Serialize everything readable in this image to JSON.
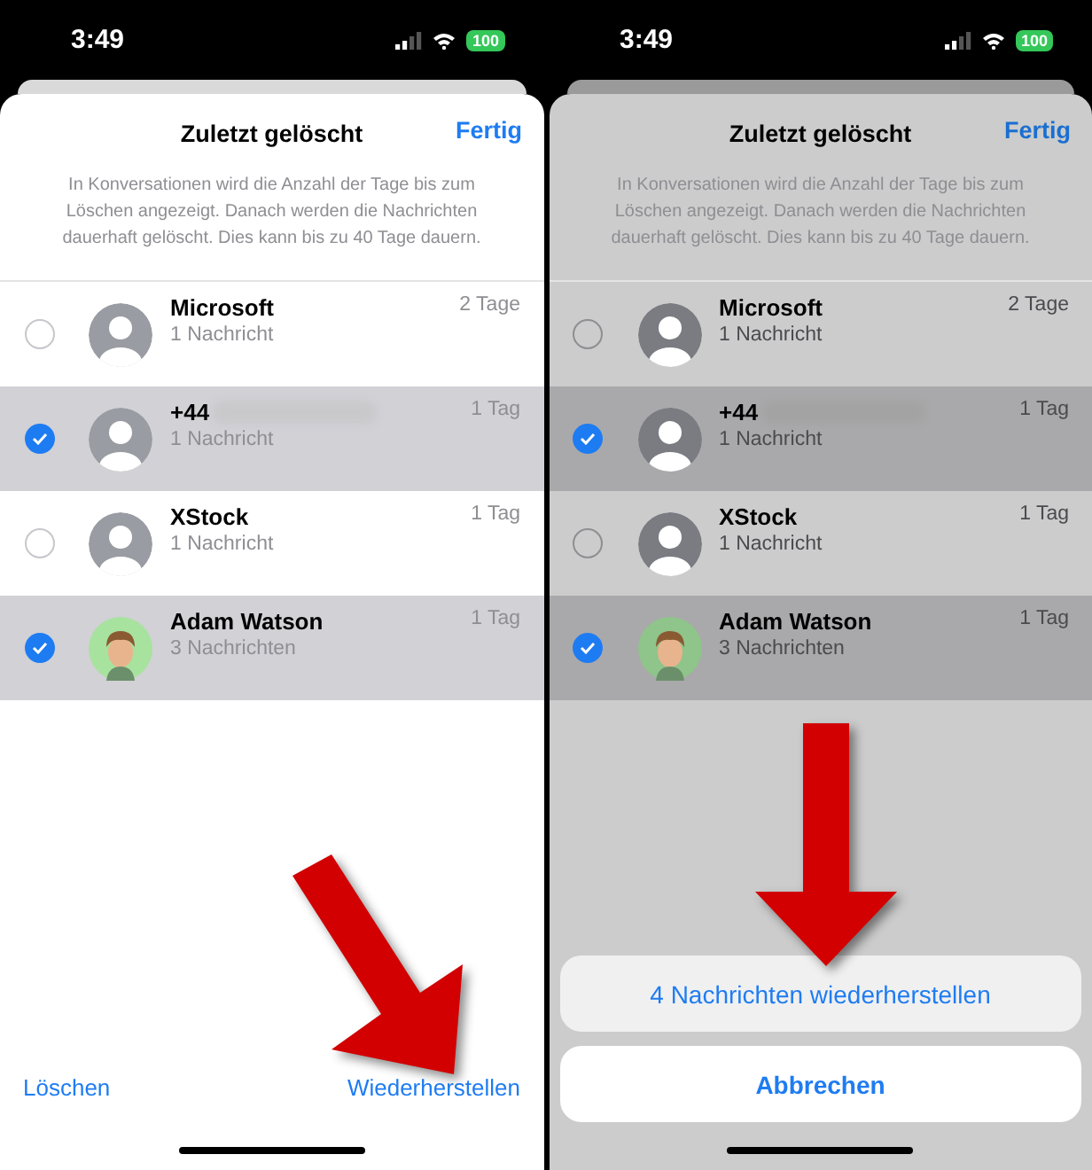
{
  "screens": [
    {
      "status_bar": {
        "time": "3:49",
        "battery": "100"
      },
      "dimmed": false,
      "sheet": {
        "title": "Zuletzt gelöscht",
        "done_button": "Fertig",
        "description": "In Konversationen wird die Anzahl der Tage bis zum Löschen angezeigt. Danach werden die Nachrichten dauerhaft gelöscht. Dies kann bis zu 40 Tage dauern.",
        "conversations": [
          {
            "name": "Microsoft",
            "count": "1 Nachricht",
            "age": "2 Tage",
            "selected": false,
            "blurred": false,
            "avatar": {
              "kind": "placeholder"
            }
          },
          {
            "name": "+44",
            "count": "1 Nachricht",
            "age": "1 Tag",
            "selected": true,
            "blurred": true,
            "avatar": {
              "kind": "placeholder"
            }
          },
          {
            "name": "XStock",
            "count": "1 Nachricht",
            "age": "1 Tag",
            "selected": false,
            "blurred": false,
            "avatar": {
              "kind": "placeholder"
            }
          },
          {
            "name": "Adam Watson",
            "count": "3 Nachrichten",
            "age": "1 Tag",
            "selected": true,
            "blurred": false,
            "avatar": {
              "kind": "memoji"
            }
          }
        ]
      },
      "toolbar": {
        "left": "Löschen",
        "right": "Wiederherstellen"
      },
      "annotation_arrow": {
        "kind": "diagonal"
      }
    },
    {
      "status_bar": {
        "time": "3:49",
        "battery": "100"
      },
      "dimmed": true,
      "sheet": {
        "title": "Zuletzt gelöscht",
        "done_button": "Fertig",
        "description": "In Konversationen wird die Anzahl der Tage bis zum Löschen angezeigt. Danach werden die Nachrichten dauerhaft gelöscht. Dies kann bis zu 40 Tage dauern.",
        "conversations": [
          {
            "name": "Microsoft",
            "count": "1 Nachricht",
            "age": "2 Tage",
            "selected": false,
            "blurred": false,
            "avatar": {
              "kind": "placeholder"
            }
          },
          {
            "name": "+44",
            "count": "1 Nachricht",
            "age": "1 Tag",
            "selected": true,
            "blurred": true,
            "avatar": {
              "kind": "placeholder"
            }
          },
          {
            "name": "XStock",
            "count": "1 Nachricht",
            "age": "1 Tag",
            "selected": false,
            "blurred": false,
            "avatar": {
              "kind": "placeholder"
            }
          },
          {
            "name": "Adam Watson",
            "count": "3 Nachrichten",
            "age": "1 Tag",
            "selected": true,
            "blurred": false,
            "avatar": {
              "kind": "memoji"
            }
          }
        ]
      },
      "action_sheet": {
        "buttons": [
          {
            "label": "4 Nachrichten wiederherstellen",
            "kind": "action"
          },
          {
            "label": "Abbrechen",
            "kind": "cancel"
          }
        ]
      },
      "annotation_arrow": {
        "kind": "down"
      }
    }
  ]
}
